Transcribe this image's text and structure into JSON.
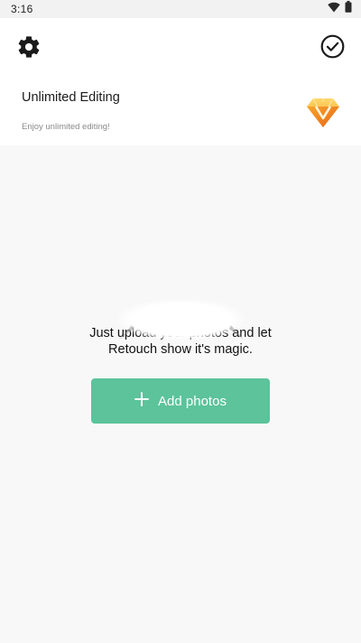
{
  "status_bar": {
    "time": "3:16",
    "icons": [
      "wifi-icon",
      "battery-icon"
    ]
  },
  "toolbar": {
    "left_icon": "gear-icon",
    "right_icon": "check-circle-icon"
  },
  "promo": {
    "title": "Unlimited Editing",
    "subtitle": "Enjoy unlimited editing!",
    "badge_icon": "diamond-badge-icon"
  },
  "empty_state": {
    "line1": "Just upload your photos and let",
    "line2": "Retouch show it's magic."
  },
  "add_button": {
    "icon": "plus-icon",
    "label": "Add photos"
  },
  "colors": {
    "accent": "#5cc39b",
    "background": "#f8f8f8",
    "card": "#ffffff",
    "badge_gold": "#f5a623",
    "badge_orange": "#f07a1a"
  }
}
